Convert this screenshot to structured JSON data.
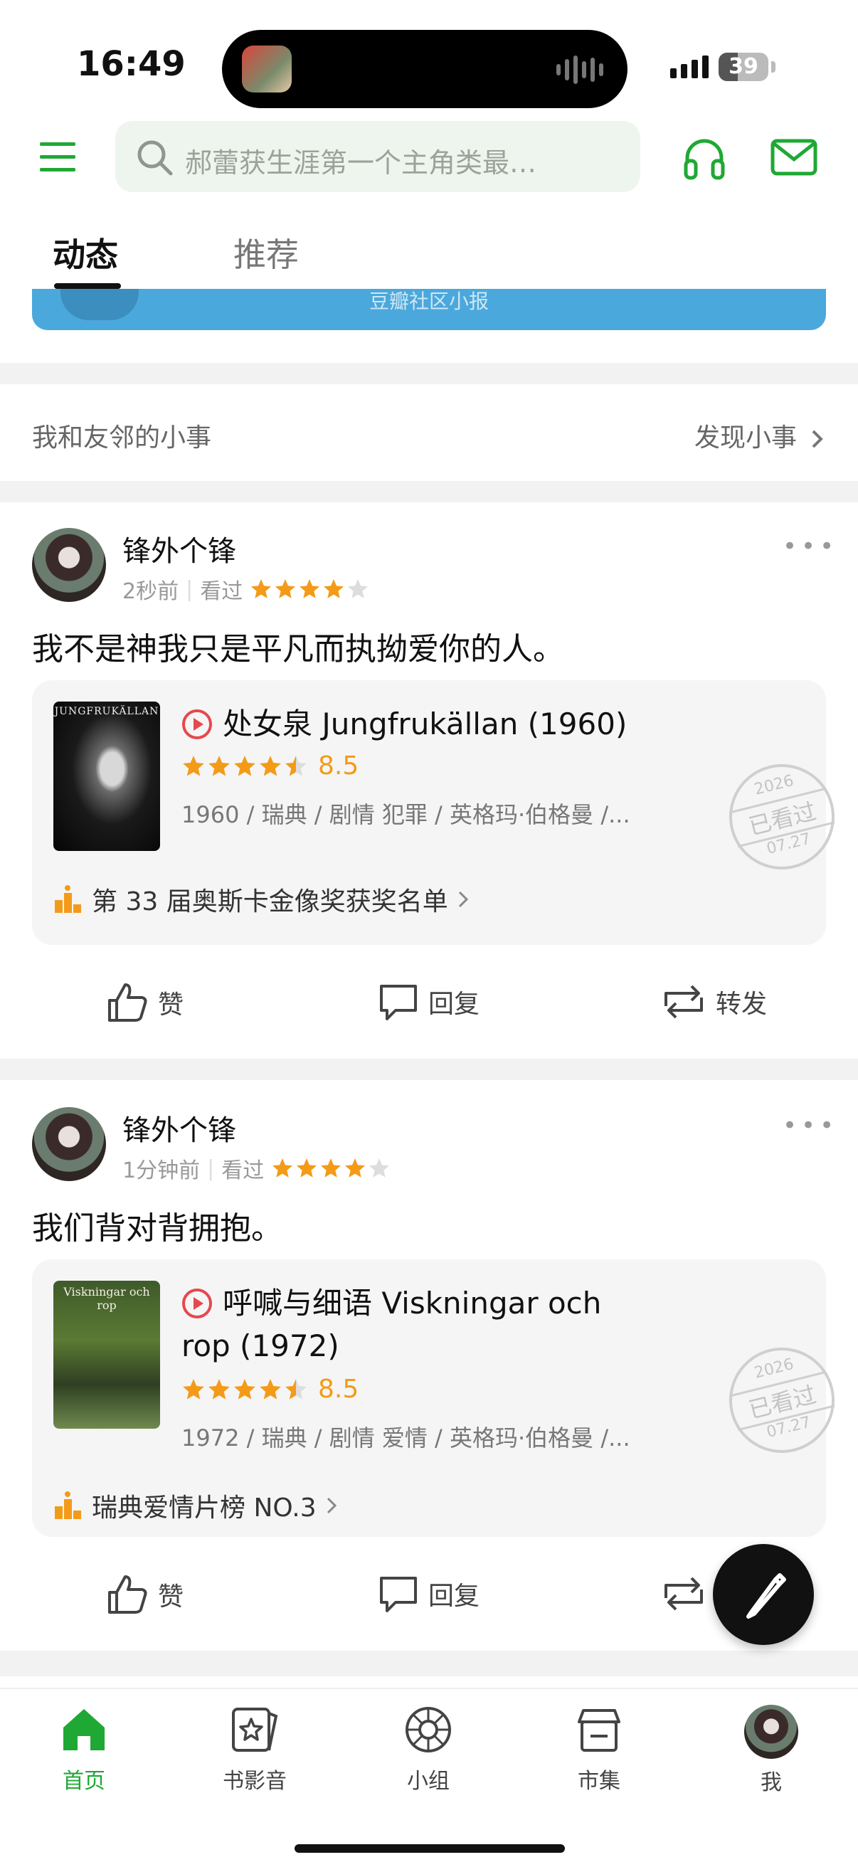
{
  "status_bar": {
    "time": "16:49",
    "battery": "39",
    "battery_level": 0.39
  },
  "search": {
    "placeholder": "郝蕾获生涯第一个主角类最…"
  },
  "tabs": [
    {
      "label": "动态",
      "active": true
    },
    {
      "label": "推荐",
      "active": false
    }
  ],
  "banner": {
    "text": "豆瓣社区小报"
  },
  "small_things": {
    "label": "我和友邻的小事",
    "link": "发现小事"
  },
  "posts": [
    {
      "username": "锋外个锋",
      "time": "2秒前",
      "status": "看过",
      "user_stars": 4,
      "text": "我不是神我只是平凡而执拗爱你的人。",
      "movie": {
        "title": "处女泉 Jungfrukällan (1960)",
        "poster_text": "JUNGFRUKÄLLAN",
        "rating": "8.5",
        "rating_stars": 4.5,
        "info": "1960 / 瑞典 / 剧情 犯罪 / 英格玛·伯格曼 /...",
        "rank": "第 33 届奥斯卡金像奖获奖名单",
        "stamp": {
          "year": "2026",
          "text": "已看过",
          "date": "07.27"
        }
      },
      "actions": {
        "like": "赞",
        "reply": "回复",
        "repost": "转发"
      }
    },
    {
      "username": "锋外个锋",
      "time": "1分钟前",
      "status": "看过",
      "user_stars": 4,
      "text": "我们背对背拥抱。",
      "movie": {
        "title_line1": "呼喊与细语 Viskningar och",
        "title_line2": "rop (1972)",
        "poster_text": "Viskningar och rop",
        "rating": "8.5",
        "rating_stars": 4.5,
        "info": "1972 / 瑞典 / 剧情 爱情 / 英格玛·伯格曼 /...",
        "rank": "瑞典爱情片榜 NO.3",
        "stamp": {
          "year": "2026",
          "text": "已看过",
          "date": "07.27"
        }
      },
      "actions": {
        "like": "赞",
        "reply": "回复"
      }
    }
  ],
  "bottom_nav": [
    {
      "label": "首页",
      "icon": "home-icon",
      "active": true
    },
    {
      "label": "书影音",
      "icon": "media-icon",
      "active": false
    },
    {
      "label": "小组",
      "icon": "group-icon",
      "active": false
    },
    {
      "label": "市集",
      "icon": "market-icon",
      "active": false
    },
    {
      "label": "我",
      "icon": "avatar",
      "active": false
    }
  ],
  "colors": {
    "brand_green": "#1fa834",
    "star_orange": "#f39b18",
    "play_red": "#e5484d"
  }
}
